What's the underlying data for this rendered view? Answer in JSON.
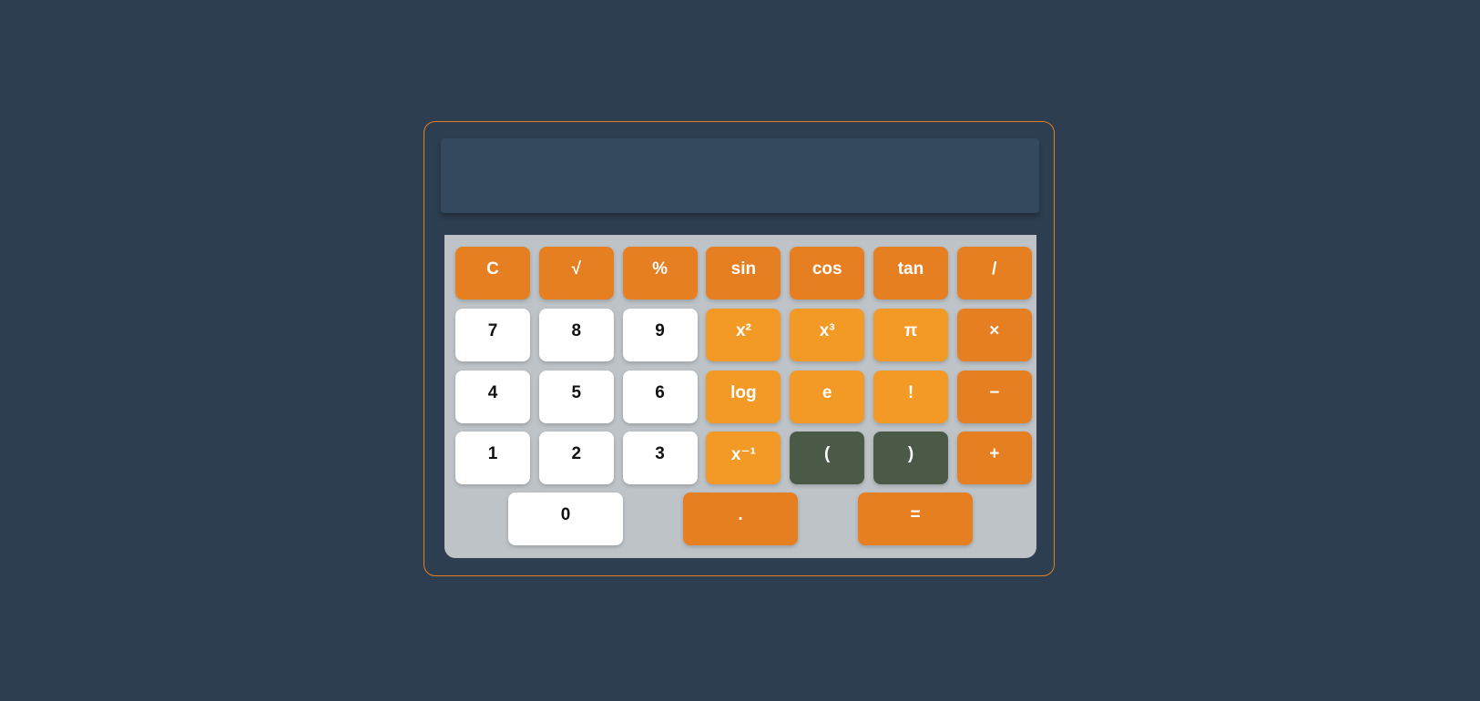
{
  "display": {
    "value": ""
  },
  "colors": {
    "background": "#2d3e51",
    "accent_orange": "#e67e22",
    "function_orange": "#f29a25",
    "number_white": "#ffffff",
    "paren_green": "#4b5a47",
    "keypad_gray": "#bdc3c7",
    "display_blue": "#34495e"
  },
  "keys": {
    "row1": [
      "C",
      "√",
      "%",
      "sin",
      "cos",
      "tan",
      "/"
    ],
    "row2": [
      "7",
      "8",
      "9",
      "x²",
      "x³",
      "π",
      "×"
    ],
    "row3": [
      "4",
      "5",
      "6",
      "log",
      "e",
      "!",
      "−"
    ],
    "row4": [
      "1",
      "2",
      "3",
      "x⁻¹",
      "(",
      ")",
      "+"
    ],
    "row5": [
      "0",
      ".",
      "="
    ]
  }
}
